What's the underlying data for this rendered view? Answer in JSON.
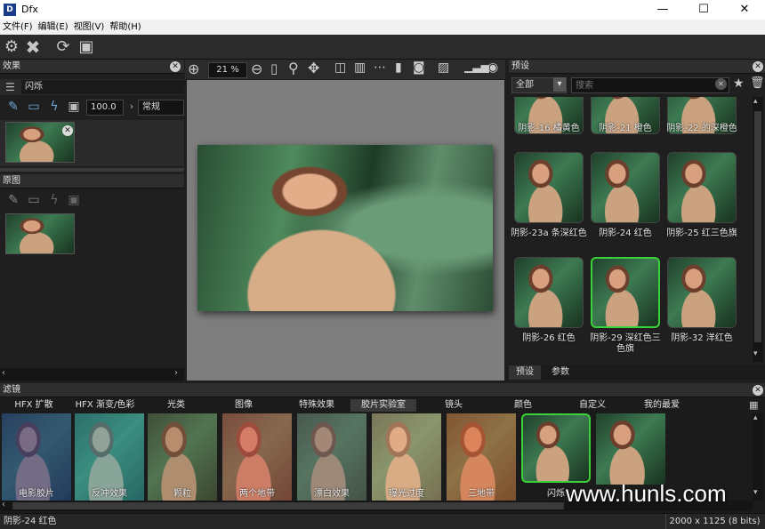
{
  "window": {
    "title": "Dfx",
    "logo": "D",
    "minimize": "—",
    "maximize": "☐",
    "close": "✕"
  },
  "menu": [
    "文件(F)",
    "编辑(E)",
    "视图(V)",
    "帮助(H)"
  ],
  "effects_panel": {
    "title": "效果",
    "effect_name": "闪烁",
    "opacity_value": "100.0",
    "blend_mode": "常规"
  },
  "original_panel": {
    "title": "原图"
  },
  "viewer": {
    "zoom": "21 %"
  },
  "presets_panel": {
    "title": "预设",
    "category": "全部",
    "search_placeholder": "搜索",
    "items": [
      {
        "label": "阴影-16 橘黄色"
      },
      {
        "label": "阴影-21 橙色"
      },
      {
        "label": "阴影-22 的深橙色"
      },
      {
        "label": "阴影-23a 条深红色"
      },
      {
        "label": "阴影-24 红色"
      },
      {
        "label": "阴影-25 红三色旗"
      },
      {
        "label": "阴影-26 红色"
      },
      {
        "label": "阴影-29 深红色三色旗"
      },
      {
        "label": "阴影-32 洋红色"
      }
    ],
    "selected_index": 7,
    "tabs": [
      "预设",
      "参数"
    ]
  },
  "filters_panel": {
    "title": "滤镜",
    "categories": [
      "HFX 扩散",
      "HFX 渐变/色彩",
      "光类",
      "图像",
      "特殊效果",
      "胶片实验室",
      "镜头",
      "颜色",
      "自定义",
      "我的最爱"
    ],
    "active_category": 5,
    "items": [
      {
        "label": "电影胶片",
        "tint": "#2c3f8a"
      },
      {
        "label": "反冲效果",
        "tint": "#3aa6b8"
      },
      {
        "label": "颗粒",
        "tint": "#7a6a50"
      },
      {
        "label": "两个地带",
        "tint": "#d0574c"
      },
      {
        "label": "漂白效果",
        "tint": "#6f6f6f"
      },
      {
        "label": "曝光过度",
        "tint": "#e8b98f"
      },
      {
        "label": "三地带",
        "tint": "#e06a3a"
      },
      {
        "label": "闪烁",
        "tint": "#4a7a58"
      },
      {
        "label": "",
        "tint": "#5a6a5a"
      }
    ],
    "selected_index": 7
  },
  "watermark": "www.hunls.com",
  "status": {
    "left": "阴影-24 红色",
    "right": "2000 x 1125 (8 bits)"
  }
}
